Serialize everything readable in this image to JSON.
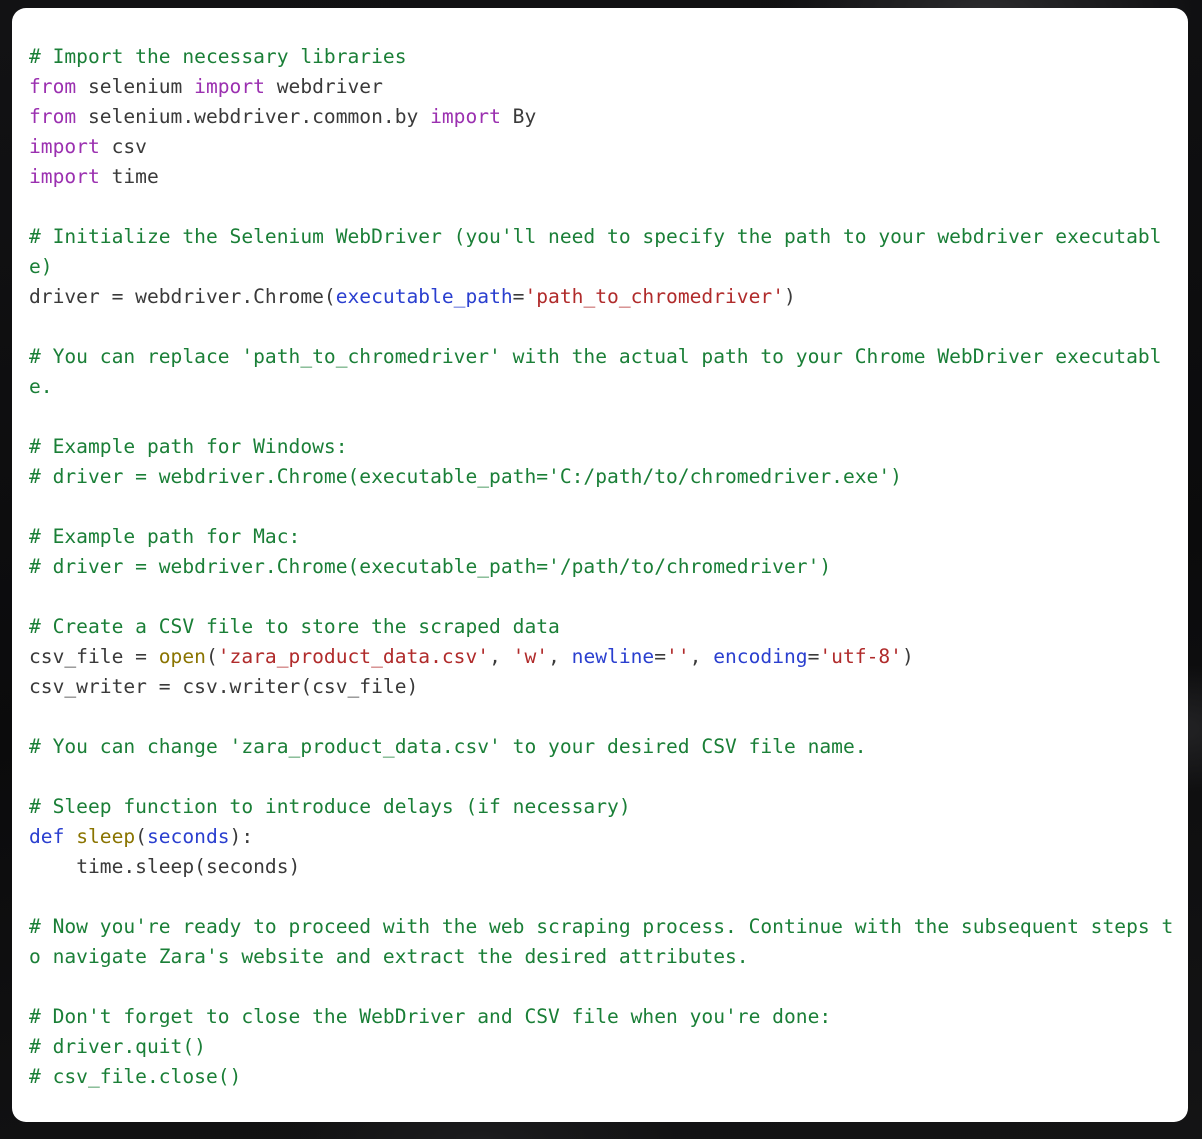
{
  "window": {
    "background_color": "#0e0e10",
    "card_background_color": "#ffffff"
  },
  "colors": {
    "comment": "#1a7f37",
    "keyword": "#9b30b0",
    "def_keyword": "#2a3fcf",
    "plain_text": "#3a3a3a",
    "string": "#b02b2b",
    "kwarg": "#2a3fcf",
    "builtin": "#8a7400",
    "function_name": "#8a7400",
    "parameter": "#2a3fcf"
  },
  "code_block": {
    "language": "python",
    "lines": [
      {
        "tokens": [
          {
            "t": "comment",
            "s": "# Import the necessary libraries"
          }
        ]
      },
      {
        "tokens": [
          {
            "t": "keyword",
            "s": "from"
          },
          {
            "t": "plain",
            "s": " selenium "
          },
          {
            "t": "keyword",
            "s": "import"
          },
          {
            "t": "plain",
            "s": " webdriver"
          }
        ]
      },
      {
        "tokens": [
          {
            "t": "keyword",
            "s": "from"
          },
          {
            "t": "plain",
            "s": " selenium.webdriver.common.by "
          },
          {
            "t": "keyword",
            "s": "import"
          },
          {
            "t": "plain",
            "s": " By"
          }
        ]
      },
      {
        "tokens": [
          {
            "t": "keyword",
            "s": "import"
          },
          {
            "t": "plain",
            "s": " csv"
          }
        ]
      },
      {
        "tokens": [
          {
            "t": "keyword",
            "s": "import"
          },
          {
            "t": "plain",
            "s": " time"
          }
        ]
      },
      {
        "tokens": []
      },
      {
        "tokens": [
          {
            "t": "comment",
            "s": "# Initialize the Selenium WebDriver (you'll need to specify the path to your webdriver executable)"
          }
        ]
      },
      {
        "tokens": [
          {
            "t": "plain",
            "s": "driver = webdriver.Chrome("
          },
          {
            "t": "kwarg",
            "s": "executable_path"
          },
          {
            "t": "plain",
            "s": "="
          },
          {
            "t": "string",
            "s": "'path_to_chromedriver'"
          },
          {
            "t": "plain",
            "s": ")"
          }
        ]
      },
      {
        "tokens": []
      },
      {
        "tokens": [
          {
            "t": "comment",
            "s": "# You can replace 'path_to_chromedriver' with the actual path to your Chrome WebDriver executable."
          }
        ]
      },
      {
        "tokens": []
      },
      {
        "tokens": [
          {
            "t": "comment",
            "s": "# Example path for Windows:"
          }
        ]
      },
      {
        "tokens": [
          {
            "t": "comment",
            "s": "# driver = webdriver.Chrome(executable_path='C:/path/to/chromedriver.exe')"
          }
        ]
      },
      {
        "tokens": []
      },
      {
        "tokens": [
          {
            "t": "comment",
            "s": "# Example path for Mac:"
          }
        ]
      },
      {
        "tokens": [
          {
            "t": "comment",
            "s": "# driver = webdriver.Chrome(executable_path='/path/to/chromedriver')"
          }
        ]
      },
      {
        "tokens": []
      },
      {
        "tokens": [
          {
            "t": "comment",
            "s": "# Create a CSV file to store the scraped data"
          }
        ]
      },
      {
        "tokens": [
          {
            "t": "plain",
            "s": "csv_file = "
          },
          {
            "t": "builtin",
            "s": "open"
          },
          {
            "t": "plain",
            "s": "("
          },
          {
            "t": "string",
            "s": "'zara_product_data.csv'"
          },
          {
            "t": "plain",
            "s": ", "
          },
          {
            "t": "string",
            "s": "'w'"
          },
          {
            "t": "plain",
            "s": ", "
          },
          {
            "t": "kwarg",
            "s": "newline"
          },
          {
            "t": "plain",
            "s": "="
          },
          {
            "t": "string",
            "s": "''"
          },
          {
            "t": "plain",
            "s": ", "
          },
          {
            "t": "kwarg",
            "s": "encoding"
          },
          {
            "t": "plain",
            "s": "="
          },
          {
            "t": "string",
            "s": "'utf-8'"
          },
          {
            "t": "plain",
            "s": ")"
          }
        ]
      },
      {
        "tokens": [
          {
            "t": "plain",
            "s": "csv_writer = csv.writer(csv_file)"
          }
        ]
      },
      {
        "tokens": []
      },
      {
        "tokens": [
          {
            "t": "comment",
            "s": "# You can change 'zara_product_data.csv' to your desired CSV file name."
          }
        ]
      },
      {
        "tokens": []
      },
      {
        "tokens": [
          {
            "t": "comment",
            "s": "# Sleep function to introduce delays (if necessary)"
          }
        ]
      },
      {
        "tokens": [
          {
            "t": "defkw",
            "s": "def"
          },
          {
            "t": "plain",
            "s": " "
          },
          {
            "t": "func",
            "s": "sleep"
          },
          {
            "t": "plain",
            "s": "("
          },
          {
            "t": "param",
            "s": "seconds"
          },
          {
            "t": "plain",
            "s": "):"
          }
        ]
      },
      {
        "tokens": [
          {
            "t": "plain",
            "s": "    time.sleep(seconds)"
          }
        ]
      },
      {
        "tokens": []
      },
      {
        "tokens": [
          {
            "t": "comment",
            "s": "# Now you're ready to proceed with the web scraping process. Continue with the subsequent steps to navigate Zara's website and extract the desired attributes."
          }
        ]
      },
      {
        "tokens": []
      },
      {
        "tokens": [
          {
            "t": "comment",
            "s": "# Don't forget to close the WebDriver and CSV file when you're done:"
          }
        ]
      },
      {
        "tokens": [
          {
            "t": "comment",
            "s": "# driver.quit()"
          }
        ]
      },
      {
        "tokens": [
          {
            "t": "comment",
            "s": "# csv_file.close()"
          }
        ]
      }
    ]
  }
}
